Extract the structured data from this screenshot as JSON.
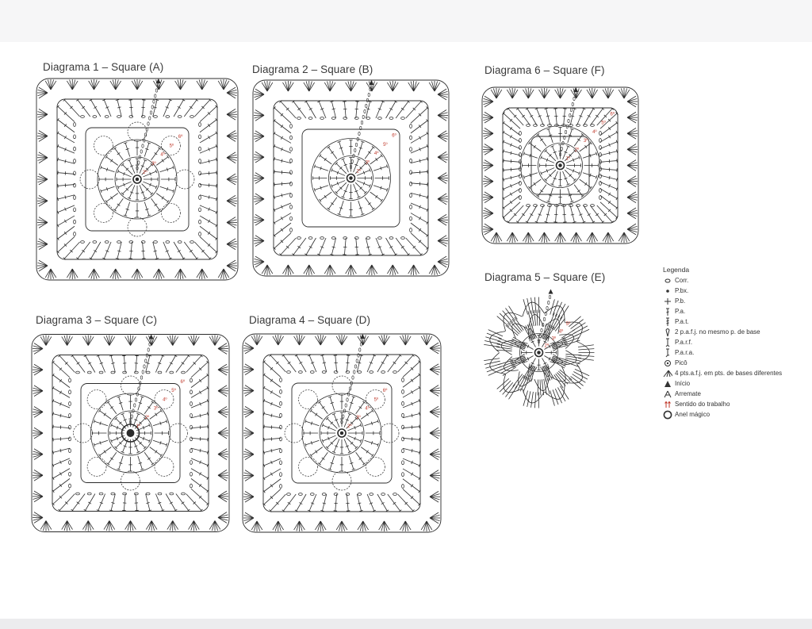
{
  "diagrams": [
    {
      "id": "d1",
      "title": "Diagrama 1 – Square (A)",
      "shape": "square",
      "rounds": [
        "2º",
        "3º",
        "4º",
        "5º",
        "6º"
      ]
    },
    {
      "id": "d2",
      "title": "Diagrama 2 – Square (B)",
      "shape": "square",
      "rounds": [
        "2º",
        "3º",
        "4º",
        "5º",
        "6º"
      ]
    },
    {
      "id": "d3",
      "title": "Diagrama 3 – Square (C)",
      "shape": "square",
      "rounds": [
        "1º",
        "2º",
        "3º",
        "4º",
        "5º",
        "6º"
      ]
    },
    {
      "id": "d4",
      "title": "Diagrama 4 – Square (D)",
      "shape": "square",
      "rounds": [
        "2º",
        "3º",
        "4º",
        "5º",
        "6º"
      ]
    },
    {
      "id": "d5",
      "title": "Diagrama 5 – Square (E)",
      "shape": "flower",
      "rounds": [
        "2º",
        "3º",
        "4º",
        "5º"
      ]
    },
    {
      "id": "d6",
      "title": "Diagrama 6 – Square (F)",
      "shape": "square",
      "rounds": [
        "1º",
        "2º",
        "3º",
        "4º",
        "5º",
        "6º"
      ]
    }
  ],
  "legend": {
    "title": "Legenda",
    "items": [
      {
        "icon": "corr-icon",
        "label": "Corr."
      },
      {
        "icon": "pbx-icon",
        "label": "P.bx."
      },
      {
        "icon": "pb-icon",
        "label": "P.b."
      },
      {
        "icon": "pa-icon",
        "label": "P.a."
      },
      {
        "icon": "pat-icon",
        "label": "P.a.t."
      },
      {
        "icon": "two-pafj-icon",
        "label": "2 p.a.f.j. no mesmo p. de base"
      },
      {
        "icon": "parf-icon",
        "label": "P.a.r.f."
      },
      {
        "icon": "para-icon",
        "label": "P.a.r.a."
      },
      {
        "icon": "pico-icon",
        "label": "Picô"
      },
      {
        "icon": "four-pafj-icon",
        "label": "4 pts.a.f.j. em pts. de bases diferentes"
      },
      {
        "icon": "inicio-icon",
        "label": "Início"
      },
      {
        "icon": "arremate-icon",
        "label": "Arremate"
      },
      {
        "icon": "sentido-icon",
        "label": "Sentido do trabalho"
      },
      {
        "icon": "anel-icon",
        "label": "Anel mágico"
      }
    ]
  },
  "colors": {
    "ink": "#2b2b2b",
    "accent": "#c0392b"
  }
}
